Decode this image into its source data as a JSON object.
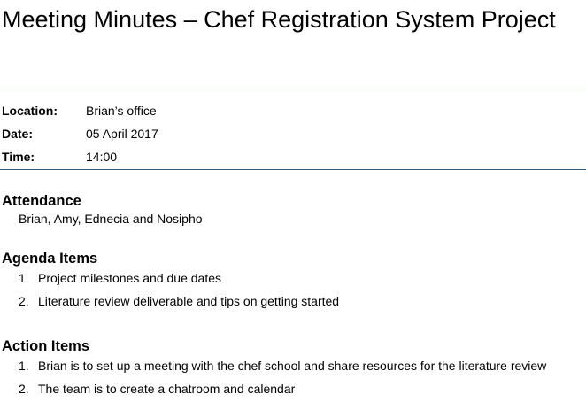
{
  "title": "Meeting Minutes – Chef Registration System Project",
  "meta": {
    "location_label": "Location:",
    "location_value": "Brian’s office",
    "date_label": "Date:",
    "date_value": "05 April 2017",
    "time_label": "Time:",
    "time_value": "14:00"
  },
  "attendance": {
    "heading": "Attendance",
    "text": "Brian, Amy, Ednecia and Nosipho"
  },
  "agenda": {
    "heading": "Agenda Items",
    "items": [
      {
        "num": "1.",
        "text": "Project milestones and due dates"
      },
      {
        "num": "2.",
        "text": "Literature review deliverable and tips on getting started"
      }
    ]
  },
  "actions": {
    "heading": "Action Items",
    "items": [
      {
        "num": "1.",
        "text": "Brian is to set up a meeting with the chef school and share resources for the literature review"
      },
      {
        "num": "2.",
        "text": "The team is to create a chatroom and calendar"
      }
    ]
  }
}
